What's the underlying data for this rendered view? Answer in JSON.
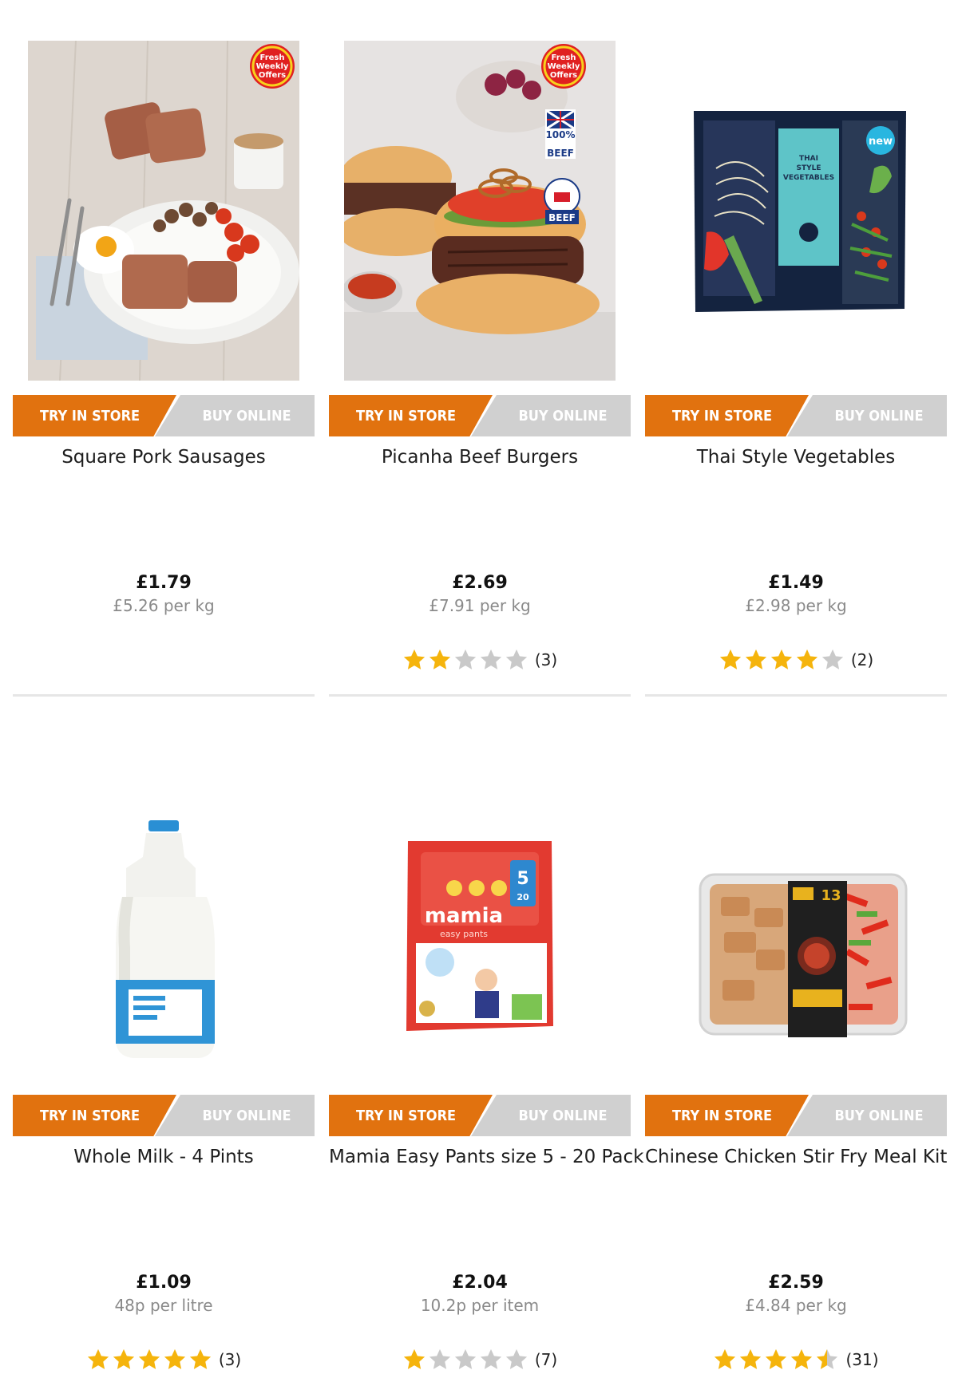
{
  "actions": {
    "try_in_store": "TRY IN STORE",
    "buy_online": "BUY ONLINE"
  },
  "colors": {
    "accent": "#e1720f",
    "star": "#f5b40c",
    "star_empty": "#c9c9c9",
    "online_btn": "#d0d0d0"
  },
  "products": [
    {
      "name": "Square Pork Sausages",
      "price": "£1.79",
      "unit_price": "£5.26 per kg",
      "rating": null,
      "review_count": "",
      "badge": "Fresh Weekly Offers",
      "image_icon": "square-sausage-breakfast-image"
    },
    {
      "name": "Picanha Beef Burgers",
      "price": "£2.69",
      "unit_price": "£7.91 per kg",
      "rating": 2,
      "review_count": "(3)",
      "badge": "Fresh Weekly Offers",
      "image_icon": "beef-burger-image",
      "labels": [
        "100% BRITISH BEEF",
        "BEEF"
      ]
    },
    {
      "name": "Thai Style Vegetables",
      "price": "£1.49",
      "unit_price": "£2.98 per kg",
      "rating": 4,
      "review_count": "(2)",
      "badge": "",
      "image_icon": "thai-vegetables-pack-image",
      "labels": [
        "new"
      ]
    },
    {
      "name": "Whole Milk - 4 Pints",
      "price": "£1.09",
      "unit_price": "48p per litre",
      "rating": 5,
      "review_count": "(3)",
      "badge": "",
      "image_icon": "milk-bottle-image"
    },
    {
      "name": "Mamia Easy Pants size 5 - 20 Pack",
      "price": "£2.04",
      "unit_price": "10.2p per item",
      "rating": 1,
      "review_count": "(7)",
      "badge": "",
      "image_icon": "nappy-pack-image",
      "labels": [
        "mamia",
        "easy pants",
        "5",
        "20"
      ]
    },
    {
      "name": "Chinese Chicken Stir Fry Meal Kit",
      "price": "£2.59",
      "unit_price": "£4.84 per kg",
      "rating": 4.5,
      "review_count": "(31)",
      "badge": "",
      "image_icon": "stir-fry-meal-kit-image",
      "labels": [
        "13"
      ]
    }
  ]
}
